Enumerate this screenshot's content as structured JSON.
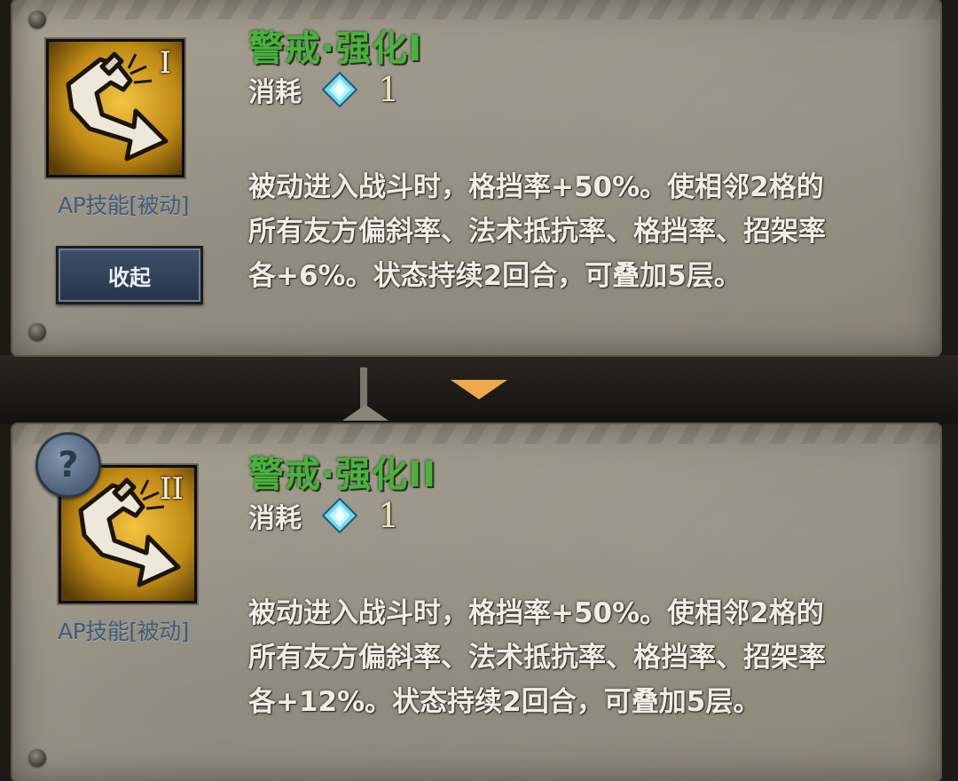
{
  "skills": [
    {
      "roman": "I",
      "name": "警戒·强化I",
      "cost_label": "消耗",
      "cost_icon": "crystal-gem-icon",
      "cost_value": "1",
      "type": "AP技能[被动]",
      "description": [
        "被动进入战斗时，格挡率+50%。使相邻2格的",
        "所有友方偏斜率、法术抵抗率、格挡率、招架率",
        "各+6%。状态持续2回合，可叠加5层。"
      ]
    },
    {
      "roman": "II",
      "name": "警戒·强化II",
      "cost_label": "消耗",
      "cost_icon": "crystal-gem-icon",
      "cost_value": "1",
      "type": "AP技能[被动]",
      "description": [
        "被动进入战斗时，格挡率+50%。使相邻2格的",
        "所有友方偏斜率、法术抵抗率、格挡率、招架率",
        "各+12%。状态持续2回合，可叠加5层。"
      ]
    }
  ],
  "collapse_button_label": "收起",
  "help_icon": "?",
  "colors": {
    "skill_name": "#49b33e",
    "skill_type": "#3f5b78",
    "cost_value": "#ece2b8",
    "divider_arrow": "#f0a94a"
  }
}
